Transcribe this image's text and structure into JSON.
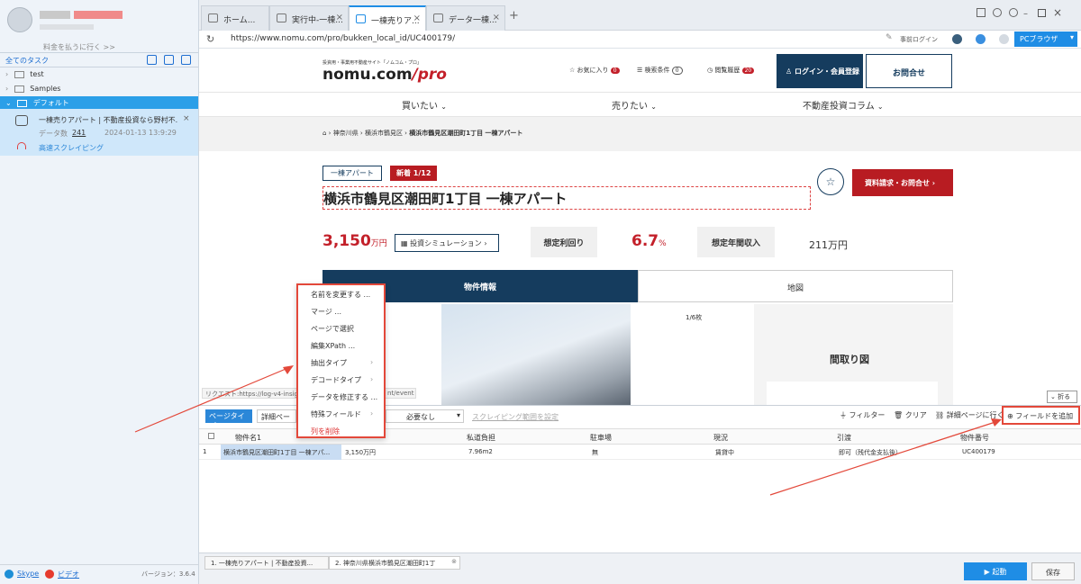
{
  "sidebar": {
    "username": "",
    "upgrade_link": "料金を払うに行く >>",
    "all_tasks": "全てのタスク",
    "folders": [
      "test",
      "Samples",
      "デフォルト"
    ],
    "task": {
      "title": "一棟売りアパート | 不動産投資なら野村不...",
      "data_label": "データ数",
      "data_count": "241",
      "timestamp": "2024-01-13 13:9:29",
      "scraping_label": "高速スクレイピング"
    },
    "footer": {
      "skype": "Skype",
      "video": "ビデオ",
      "version": "バージョン：3.6.4"
    }
  },
  "tabs": [
    {
      "label": "ホーム..."
    },
    {
      "label": "実行中-一棟..."
    },
    {
      "label": "一棟売りア..."
    },
    {
      "label": "データ一棟..."
    }
  ],
  "address": {
    "url": "https://www.nomu.com/pro/bukken_local_id/UC400179/",
    "login": "事前ログイン",
    "browser": "PCブラウザ"
  },
  "site": {
    "tagline": "投資用・事業用不動産サイト「ノムコム・プロ」",
    "logo": "nomu.com",
    "logo_pro": "/pro",
    "favorites": "お気に入り",
    "favorites_count": "0",
    "search_cond": "検索条件",
    "search_count": "0",
    "history": "閲覧履歴",
    "history_count": "20",
    "login_btn": "ログイン・会員登録",
    "contact_btn": "お問合せ",
    "nav": [
      "買いたい",
      "売りたい",
      "不動産投資コラム"
    ],
    "breadcrumb": [
      "神奈川県",
      "横浜市鶴見区",
      "横浜市鶴見区潮田町1丁目 一棟アパート"
    ],
    "tag_type": "一棟アパート",
    "tag_new": "新着 1/12",
    "title": "横浜市鶴見区潮田町1丁目 一棟アパート",
    "request_btn": "資料請求・お問合せ",
    "price": "3,150",
    "price_unit": "万円",
    "sim_btn": "投資シミュレーション",
    "yield_label": "想定利回り",
    "yield_value": "6.7",
    "yield_unit": "%",
    "income_label": "想定年間収入",
    "income_value": "211万円",
    "tab_info": "物件情報",
    "tab_map": "地図",
    "photo_count": "1/6枚",
    "floorplan": "間取り図",
    "request_url": "リクエスト:https://log-v4-insig",
    "request_url_end": "nt/event",
    "fold": "折る"
  },
  "context_menu": [
    "名前を変更する ...",
    "マージ ...",
    "ページで選択",
    "編集XPath ...",
    "抽出タイプ",
    "デコードタイプ",
    "データを修正する ...",
    "特殊フィールド",
    "列を削除"
  ],
  "panel": {
    "page_type": "ページタイプ",
    "detail_page": "詳細ペー",
    "not_needed": "必要なし",
    "scrape_range": "スクレイピング範囲を設定",
    "filter": "フィルター",
    "clear": "クリア",
    "goto_detail": "詳細ページに行く",
    "add_field": "フィールドを追加",
    "columns": [
      "物件名1",
      "",
      "私道負担",
      "駐車場",
      "現況",
      "引渡",
      "物件番号"
    ],
    "row_no": "1",
    "row": [
      "横浜市鶴見区潮田町1丁目 一棟アパ...",
      "3,150万円",
      "7.96m2",
      "無",
      "賃貸中",
      "即可（残代金支払後）",
      "UC400179"
    ]
  },
  "status": {
    "tabs": [
      "1. 一棟売りアパート | 不動産投資...",
      "2. 神奈川県横浜市鶴見区潮田町1丁"
    ],
    "start": "起動",
    "save": "保存"
  }
}
